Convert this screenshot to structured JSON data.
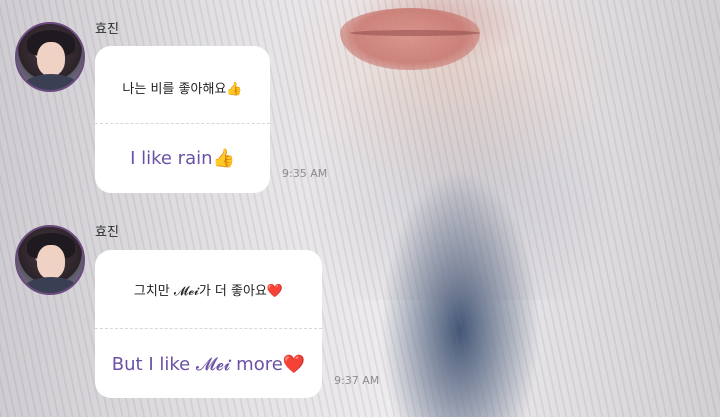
{
  "messages": [
    {
      "sender": "효진",
      "korean": "나는 비를 좋아해요👍",
      "english": "I like rain👍",
      "time": "9:35 AM",
      "avatar_icon": "profile-photo-icon"
    },
    {
      "sender": "효진",
      "korean": "그치만 𝓜𝓮𝓲가 더 좋아요❤️",
      "english": "But I like 𝓜𝓮𝓲 more❤️",
      "time": "9:37 AM",
      "avatar_icon": "profile-photo-icon"
    }
  ],
  "colors": {
    "translation_text": "#6b52a6",
    "bubble": "#ffffff",
    "timestamp": "#8d8b90"
  }
}
